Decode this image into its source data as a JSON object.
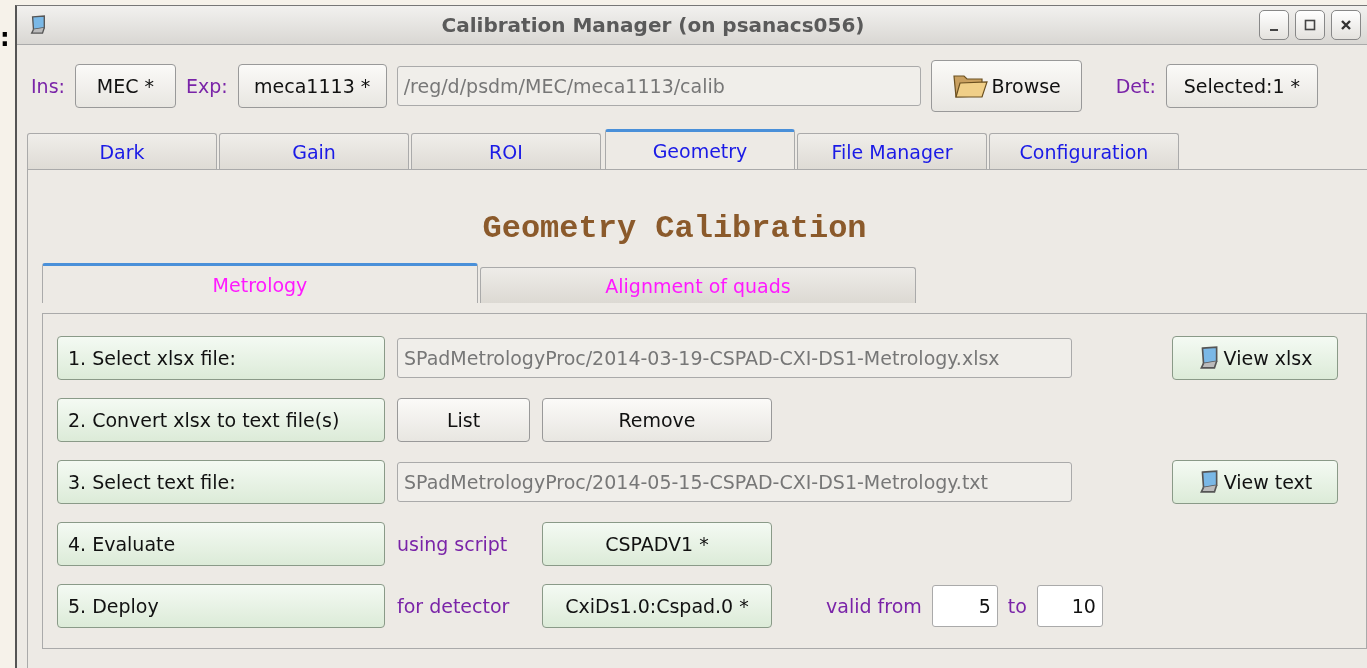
{
  "edge_text": ":",
  "window": {
    "title": "Calibration Manager (on psanacs056)"
  },
  "toolbar": {
    "ins_label": "Ins:",
    "ins_value": "MEC *",
    "exp_label": "Exp:",
    "exp_value": "meca1113 *",
    "path": "/reg/d/psdm/MEC/meca1113/calib",
    "browse": "Browse",
    "det_label": "Det:",
    "det_value": "Selected:1 *"
  },
  "tabs": [
    {
      "label": "Dark",
      "selected": false
    },
    {
      "label": "Gain",
      "selected": false
    },
    {
      "label": "ROI",
      "selected": false
    },
    {
      "label": "Geometry",
      "selected": true
    },
    {
      "label": "File Manager",
      "selected": false
    },
    {
      "label": "Configuration",
      "selected": false
    }
  ],
  "heading": "Geometry Calibration",
  "subtabs": [
    {
      "label": "Metrology",
      "selected": true
    },
    {
      "label": "Alignment of quads",
      "selected": false
    }
  ],
  "steps": [
    {
      "button": "1. Select xlsx file:",
      "items": [
        {
          "kind": "field",
          "value": "SPadMetrologyProc/2014-03-19-CSPAD-CXI-DS1-Metrology.xlsx"
        },
        {
          "kind": "view",
          "label": "View xlsx"
        }
      ]
    },
    {
      "button": "2. Convert xlsx to text file(s)",
      "items": [
        {
          "kind": "button",
          "label": "List",
          "highlighted": false
        },
        {
          "kind": "button",
          "label": "Remove",
          "highlighted": false
        }
      ]
    },
    {
      "button": "3. Select text file:",
      "items": [
        {
          "kind": "field",
          "value": "SPadMetrologyProc/2014-05-15-CSPAD-CXI-DS1-Metrology.txt"
        },
        {
          "kind": "view",
          "label": "View text"
        }
      ]
    },
    {
      "button": "4. Evaluate",
      "items": [
        {
          "kind": "label",
          "text": "using script"
        },
        {
          "kind": "button",
          "label": "CSPADV1 *",
          "highlighted": true
        }
      ]
    },
    {
      "button": "5. Deploy",
      "items": [
        {
          "kind": "label",
          "text": "for detector"
        },
        {
          "kind": "button",
          "label": "CxiDs1.0:Cspad.0 *",
          "highlighted": true
        },
        {
          "kind": "range",
          "from_label": "valid from",
          "from": "5",
          "to_label": "to",
          "to": "10"
        }
      ]
    }
  ]
}
